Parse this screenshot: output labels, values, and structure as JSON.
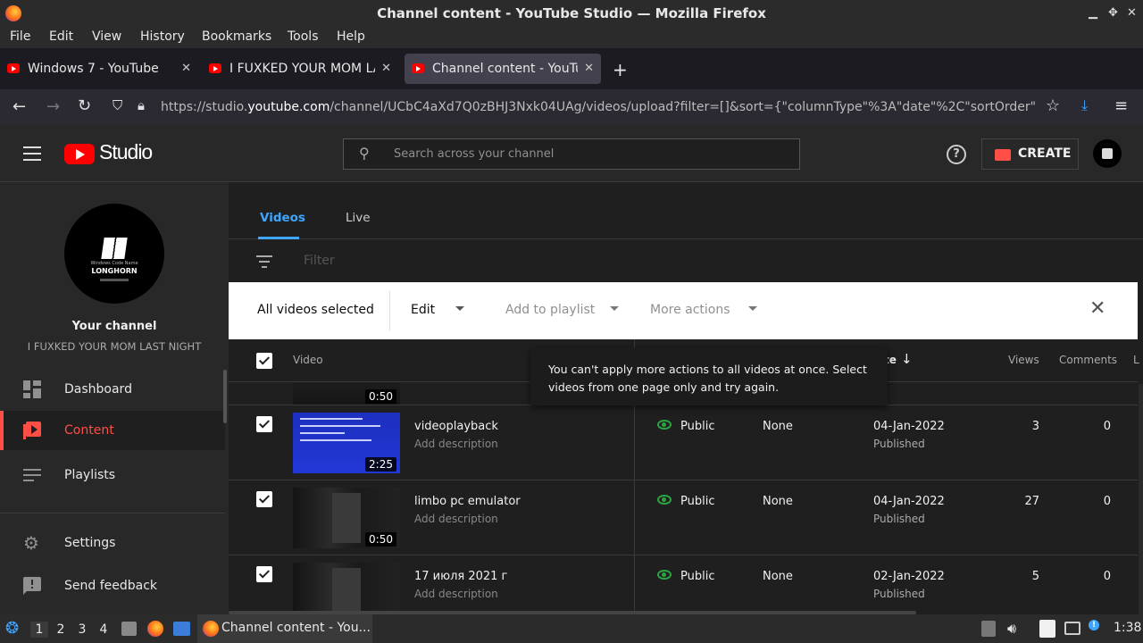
{
  "window": {
    "title": "Channel content - YouTube Studio — Mozilla Firefox"
  },
  "menu": [
    "File",
    "Edit",
    "View",
    "History",
    "Bookmarks",
    "Tools",
    "Help"
  ],
  "tabs": [
    {
      "label": "Windows 7 - YouTube"
    },
    {
      "label": "I FUXKED YOUR MOM LAS"
    },
    {
      "label": "Channel content - YouTub"
    }
  ],
  "url": {
    "scheme": "https://studio.",
    "host": "youtube.com",
    "path": "/channel/UCbC4aXd7Q0zBHJ3Nxk04UAg/videos/upload?filter=[]&sort={\"columnType\"%3A\"date\"%2C\"sortOrder\""
  },
  "studio": {
    "logo_text": "Studio",
    "search_placeholder": "Search across your channel",
    "create_label": "CREATE"
  },
  "channel": {
    "your_channel": "Your channel",
    "name": "I FUXKED YOUR MOM LAST NIGHT",
    "avatar_text": "LONGHORN",
    "avatar_small": "Windows Code Name"
  },
  "sidebar": {
    "items": [
      {
        "label": "Dashboard"
      },
      {
        "label": "Content"
      },
      {
        "label": "Playlists"
      }
    ],
    "bottom": [
      {
        "label": "Settings"
      },
      {
        "label": "Send feedback"
      }
    ]
  },
  "content": {
    "tabs": [
      "Videos",
      "Live"
    ],
    "filter_placeholder": "Filter",
    "selection_bar": {
      "selected": "All videos selected",
      "edit": "Edit",
      "add_to_playlist": "Add to playlist",
      "more_actions": "More actions"
    },
    "columns": {
      "video": "Video",
      "date": "te",
      "views": "Views",
      "comments": "Comments",
      "likes": "L"
    },
    "tooltip": "You can't apply more actions to all videos at once. Select videos from one page only and try again.",
    "partial_row": {
      "duration": "0:50"
    },
    "rows": [
      {
        "title": "videoplayback",
        "desc": "Add description",
        "duration": "2:25",
        "visibility": "Public",
        "restrictions": "None",
        "date": "04-Jan-2022",
        "status": "Published",
        "views": "3",
        "comments": "0"
      },
      {
        "title": "limbo pc emulator",
        "desc": "Add description",
        "duration": "0:50",
        "visibility": "Public",
        "restrictions": "None",
        "date": "04-Jan-2022",
        "status": "Published",
        "views": "27",
        "comments": "0"
      },
      {
        "title": "17 июля 2021 г",
        "desc": "Add description",
        "duration": "",
        "visibility": "Public",
        "restrictions": "None",
        "date": "02-Jan-2022",
        "status": "Published",
        "views": "5",
        "comments": "0"
      }
    ]
  },
  "taskbar": {
    "workspaces": [
      "1",
      "2",
      "3",
      "4"
    ],
    "window_label": "Channel content - You...",
    "clock": "1:38"
  },
  "colors": {
    "accent": "#3ea6ff",
    "youtube_red": "#ff0000",
    "content_active": "#ff4e45",
    "public_green": "#2ba640"
  }
}
